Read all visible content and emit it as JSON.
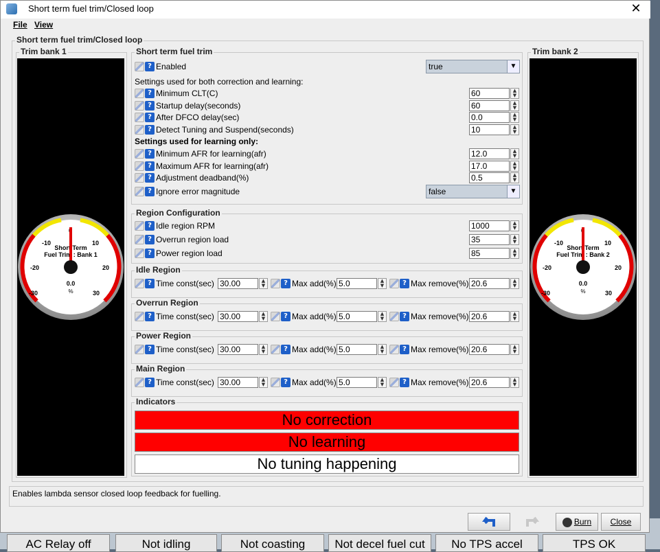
{
  "window": {
    "title": "Short term fuel trim/Closed loop",
    "close_glyph": "✕"
  },
  "menu": {
    "file": "File",
    "view": "View"
  },
  "panel_title": "Short term fuel trim/Closed loop",
  "trim_bank_1": {
    "title": "Trim bank 1",
    "gauge": {
      "label_line1": "Short Term",
      "label_line2": "Fuel Trim : Bank 1",
      "value": "0.0",
      "unit": "%",
      "ticks": [
        "-30",
        "-20",
        "-10",
        "0",
        "10",
        "20",
        "30"
      ]
    }
  },
  "trim_bank_2": {
    "title": "Trim bank 2",
    "gauge": {
      "label_line1": "Short Term",
      "label_line2": "Fuel Trim : Bank 2",
      "value": "0.0",
      "unit": "%",
      "ticks": [
        "-30",
        "-20",
        "-10",
        "0",
        "10",
        "20",
        "30"
      ]
    }
  },
  "stft": {
    "title": "Short term fuel trim",
    "enabled_label": "Enabled",
    "enabled_value": "true",
    "both_heading": "Settings used for both correction and learning:",
    "min_clt_label": "Minimum CLT(C)",
    "min_clt": "60",
    "startup_label": "Startup delay(seconds)",
    "startup": "60",
    "dfco_label": "After DFCO delay(sec)",
    "dfco": "0.0",
    "detect_label": "Detect Tuning and Suspend(seconds)",
    "detect": "10",
    "learning_heading": "Settings used for learning only:",
    "min_afr_label": "Minimum AFR for learning(afr)",
    "min_afr": "12.0",
    "max_afr_label": "Maximum AFR for learning(afr)",
    "max_afr": "17.0",
    "deadband_label": "Adjustment deadband(%)",
    "deadband": "0.5",
    "ignore_label": "Ignore error magnitude",
    "ignore_value": "false"
  },
  "region_config": {
    "title": "Region Configuration",
    "idle_rpm_label": "Idle region RPM",
    "idle_rpm": "1000",
    "overrun_label": "Overrun region load",
    "overrun": "35",
    "power_label": "Power region load",
    "power": "85"
  },
  "regions": [
    {
      "title": "Idle Region",
      "tc_label": "Time const(sec)",
      "tc": "30.00",
      "add_label": "Max add(%)",
      "add": "5.0",
      "rem_label": "Max remove(%)",
      "rem": "20.6"
    },
    {
      "title": "Overrun Region",
      "tc_label": "Time const(sec)",
      "tc": "30.00",
      "add_label": "Max add(%)",
      "add": "5.0",
      "rem_label": "Max remove(%)",
      "rem": "20.6"
    },
    {
      "title": "Power Region",
      "tc_label": "Time const(sec)",
      "tc": "30.00",
      "add_label": "Max add(%)",
      "add": "5.0",
      "rem_label": "Max remove(%)",
      "rem": "20.6"
    },
    {
      "title": "Main Region",
      "tc_label": "Time const(sec)",
      "tc": "30.00",
      "add_label": "Max add(%)",
      "add": "5.0",
      "rem_label": "Max remove(%)",
      "rem": "20.6"
    }
  ],
  "indicators": {
    "title": "Indicators",
    "items": [
      {
        "text": "No correction",
        "color": "#ff0000"
      },
      {
        "text": "No learning",
        "color": "#ff0000"
      },
      {
        "text": "No tuning happening",
        "color": "#ffffff"
      }
    ]
  },
  "status_message": "Enables lambda sensor closed loop feedback for fuelling.",
  "footer": {
    "burn": "Burn",
    "close": "Close"
  },
  "background_indicators": [
    "AC Relay off",
    "Not idling",
    "Not coasting",
    "Not decel fuel cut",
    "No TPS accel",
    "TPS OK"
  ],
  "colors": {
    "gauge_red": "#e00000",
    "gauge_yellow": "#f2e600",
    "accent_blue": "#1e5fc8"
  }
}
